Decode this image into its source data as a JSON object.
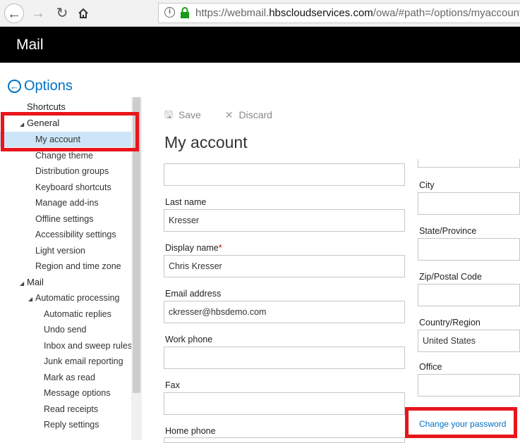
{
  "browser": {
    "url_prefix": "https://webmail.",
    "url_domain": "hbscloudservices.com",
    "url_suffix": "/owa/#path=/options/myaccount"
  },
  "app": {
    "title": "Mail"
  },
  "sidebar": {
    "header": "Options",
    "items": [
      {
        "label": "Shortcuts"
      },
      {
        "label": "General"
      },
      {
        "label": "My account"
      },
      {
        "label": "Change theme"
      },
      {
        "label": "Distribution groups"
      },
      {
        "label": "Keyboard shortcuts"
      },
      {
        "label": "Manage add-ins"
      },
      {
        "label": "Offline settings"
      },
      {
        "label": "Accessibility settings"
      },
      {
        "label": "Light version"
      },
      {
        "label": "Region and time zone"
      },
      {
        "label": "Mail"
      },
      {
        "label": "Automatic processing"
      },
      {
        "label": "Automatic replies"
      },
      {
        "label": "Undo send"
      },
      {
        "label": "Inbox and sweep rules"
      },
      {
        "label": "Junk email reporting"
      },
      {
        "label": "Mark as read"
      },
      {
        "label": "Message options"
      },
      {
        "label": "Read receipts"
      },
      {
        "label": "Reply settings"
      }
    ]
  },
  "toolbar": {
    "save_label": "Save",
    "discard_label": "Discard"
  },
  "page": {
    "title": "My account"
  },
  "form": {
    "last_name_label": "Last name",
    "last_name_value": "Kresser",
    "display_name_label": "Display name",
    "display_name_required": "*",
    "display_name_value": "Chris Kresser",
    "email_label": "Email address",
    "email_value": "ckresser@hbsdemo.com",
    "work_phone_label": "Work phone",
    "fax_label": "Fax",
    "home_phone_label": "Home phone",
    "city_label": "City",
    "state_label": "State/Province",
    "zip_label": "Zip/Postal Code",
    "country_label": "Country/Region",
    "country_value": "United States",
    "office_label": "Office",
    "change_password_label": "Change your password"
  },
  "colors": {
    "accent": "#0072c6",
    "highlight_box": "#e8151b",
    "selected_bg": "#cde6f7"
  }
}
